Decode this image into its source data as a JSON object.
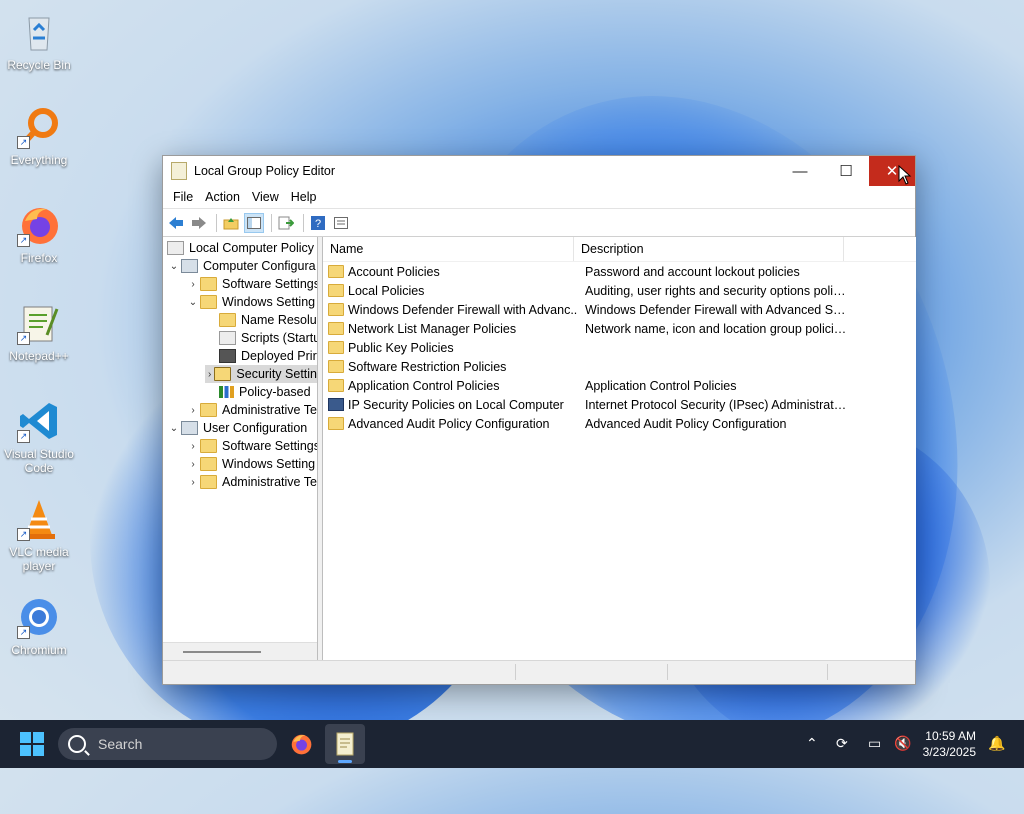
{
  "desktop": {
    "icons": [
      {
        "label": "Recycle Bin"
      },
      {
        "label": "Everything"
      },
      {
        "label": "Firefox"
      },
      {
        "label": "Notepad++"
      },
      {
        "label": "Visual Studio Code"
      },
      {
        "label": "VLC media player"
      },
      {
        "label": "Chromium"
      }
    ]
  },
  "window": {
    "title": "Local Group Policy Editor",
    "controls": {
      "minimize": "—",
      "maximize": "☐",
      "close": "✕"
    },
    "menu": [
      "File",
      "Action",
      "View",
      "Help"
    ],
    "toolbar": [
      "back-icon",
      "forward-icon",
      "up-folder-icon",
      "show-hide-tree-icon",
      "export-list-icon",
      "help-icon",
      "properties-icon"
    ]
  },
  "tree": [
    {
      "label": "Local Computer Policy",
      "icon": "policy"
    },
    {
      "label": "Computer Configura",
      "icon": "pc"
    },
    {
      "label": "Software Settings",
      "icon": "folder"
    },
    {
      "label": "Windows Setting",
      "icon": "folder"
    },
    {
      "label": "Name Resolu",
      "icon": "folder"
    },
    {
      "label": "Scripts (Startu",
      "icon": "scroll"
    },
    {
      "label": "Deployed Prir",
      "icon": "printer"
    },
    {
      "label": "Security Settin",
      "icon": "security"
    },
    {
      "label": "Policy-based",
      "icon": "chart"
    },
    {
      "label": "Administrative Te",
      "icon": "folder"
    },
    {
      "label": "User Configuration",
      "icon": "pc"
    },
    {
      "label": "Software Settings",
      "icon": "folder"
    },
    {
      "label": "Windows Setting",
      "icon": "folder"
    },
    {
      "label": "Administrative Te",
      "icon": "folder"
    }
  ],
  "list": {
    "columns": [
      "Name",
      "Description"
    ],
    "rows": [
      {
        "name": "Account Policies",
        "description": "Password and account lockout policies"
      },
      {
        "name": "Local Policies",
        "description": "Auditing, user rights and security options polici..."
      },
      {
        "name": "Windows Defender Firewall with Advanc...",
        "description": "Windows Defender Firewall with Advanced Sec..."
      },
      {
        "name": "Network List Manager Policies",
        "description": "Network name, icon and location group policies."
      },
      {
        "name": "Public Key Policies",
        "description": ""
      },
      {
        "name": "Software Restriction Policies",
        "description": ""
      },
      {
        "name": "Application Control Policies",
        "description": "Application Control Policies"
      },
      {
        "name": "IP Security Policies on Local Computer",
        "description": "Internet Protocol Security (IPsec) Administratio..."
      },
      {
        "name": "Advanced Audit Policy Configuration",
        "description": "Advanced Audit Policy Configuration"
      }
    ]
  },
  "taskbar": {
    "search_placeholder": "Search",
    "time": "10:59 AM",
    "date": "3/23/2025",
    "accent": "#4cc2ff"
  }
}
